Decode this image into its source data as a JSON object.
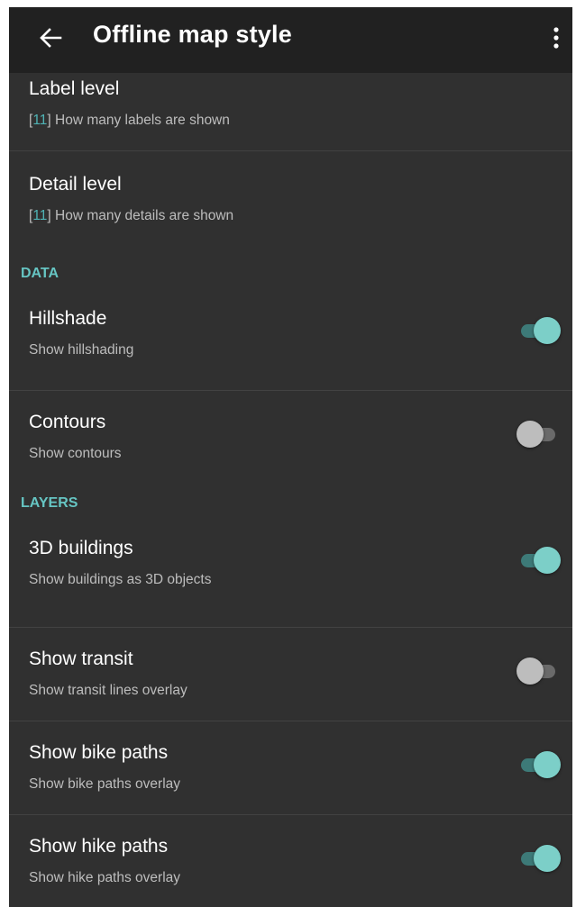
{
  "appbar": {
    "title": "Offline map style",
    "back_icon": "arrow-back-icon",
    "overflow_icon": "more-vert-icon"
  },
  "colors": {
    "background": "#303030",
    "appbar": "#212121",
    "accent": "#66c5c3",
    "switch_on_thumb": "#7ccfc8",
    "switch_off_thumb": "#bdbdbd"
  },
  "list": {
    "label_level": {
      "title": "Label level",
      "value": "11",
      "summary": "How many labels are shown"
    },
    "detail_level": {
      "title": "Detail level",
      "value": "11",
      "summary": "How many details are shown"
    },
    "data_section": {
      "header": "DATA",
      "hillshade": {
        "title": "Hillshade",
        "summary": "Show hillshading",
        "checked": true
      },
      "contours": {
        "title": "Contours",
        "summary": "Show contours",
        "checked": false
      }
    },
    "layers_section": {
      "header": "LAYERS",
      "buildings_3d": {
        "title": "3D buildings",
        "summary": "Show buildings as 3D objects",
        "checked": true
      },
      "transit": {
        "title": "Show transit",
        "summary": "Show transit lines overlay",
        "checked": false
      },
      "bike_paths": {
        "title": "Show bike paths",
        "summary": "Show bike paths overlay",
        "checked": true
      },
      "hike_paths": {
        "title": "Show hike paths",
        "summary": "Show hike paths overlay",
        "checked": true
      }
    }
  }
}
